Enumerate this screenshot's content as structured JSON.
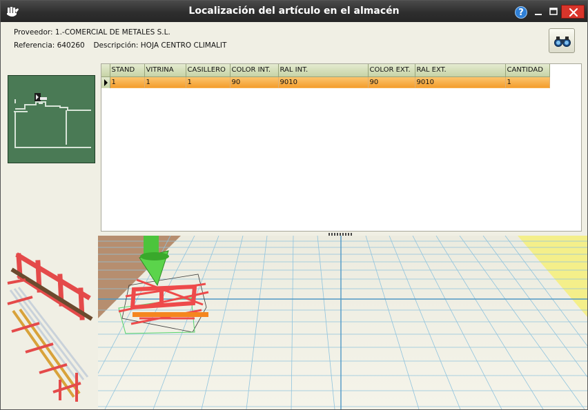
{
  "window": {
    "title": "Localización del artículo en el almacén",
    "help_label": "?"
  },
  "article": {
    "provider_label": "Proveedor:",
    "provider_value": "1.-COMERCIAL DE METALES S.L.",
    "reference_label": "Referencia:",
    "reference_value": "640260",
    "description_label": "Descripción:",
    "description_value": "HOJA CENTRO CLIMALIT"
  },
  "grid": {
    "columns": [
      "STAND",
      "VITRINA",
      "CASILLERO",
      "COLOR INT.",
      "RAL INT.",
      "COLOR EXT.",
      "RAL EXT.",
      "CANTIDAD"
    ],
    "rows": [
      [
        "1",
        "1",
        "1",
        "90",
        "9010",
        "90",
        "9010",
        "1"
      ]
    ]
  },
  "colors": {
    "selected_row": "#f39c2b",
    "header": "#c7d3a6",
    "minimap_bg": "#4a7a55",
    "floor_grid": "#79b4d6",
    "marker_arrow": "#4cc43c",
    "rack": "#e84a4a",
    "close_button": "#d9352b"
  },
  "icons": {
    "app": "hand-logo-icon",
    "search": "binoculars-icon",
    "help": "help-icon",
    "minimize": "minimize-icon",
    "maximize": "maximize-icon",
    "close": "close-icon"
  }
}
